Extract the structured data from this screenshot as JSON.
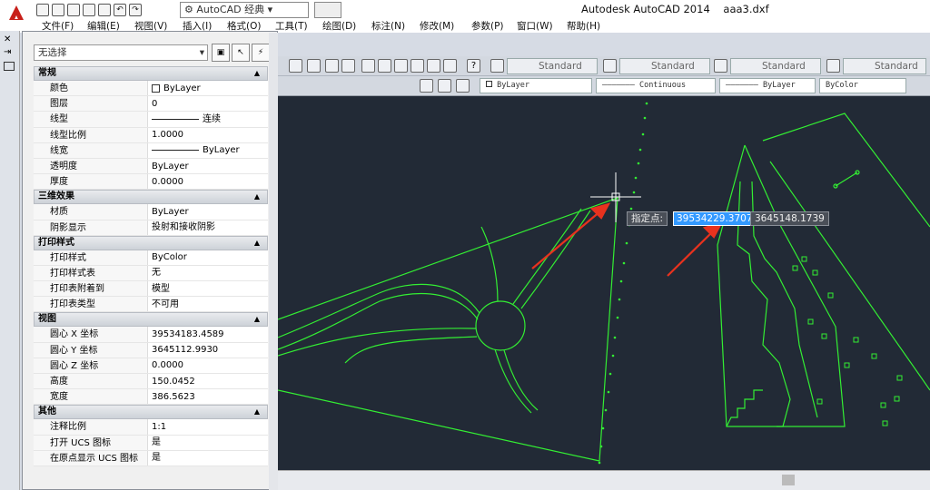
{
  "app": {
    "title": "Autodesk AutoCAD 2014",
    "filename": "aaa3.dxf",
    "workspace": "AutoCAD 经典"
  },
  "menu": [
    "文件(F)",
    "编辑(E)",
    "视图(V)",
    "插入(I)",
    "格式(O)",
    "工具(T)",
    "绘图(D)",
    "标注(N)",
    "修改(M)",
    "参数(P)",
    "窗口(W)",
    "帮助(H)"
  ],
  "toolbar": {
    "styles": [
      "Standard",
      "Standard",
      "Standard",
      "Standard"
    ],
    "layer_color": "ByLayer",
    "linetype": "Continuous",
    "lineweight": "ByLayer",
    "plotstyle": "ByColor"
  },
  "properties": {
    "selection": "无选择",
    "sections": [
      {
        "title": "常规",
        "rows": [
          {
            "k": "颜色",
            "v": "ByLayer",
            "swatch": true
          },
          {
            "k": "图层",
            "v": "0"
          },
          {
            "k": "线型",
            "v": "连续",
            "line": true
          },
          {
            "k": "线型比例",
            "v": "1.0000"
          },
          {
            "k": "线宽",
            "v": "ByLayer",
            "line": true
          },
          {
            "k": "透明度",
            "v": "ByLayer"
          },
          {
            "k": "厚度",
            "v": "0.0000"
          }
        ]
      },
      {
        "title": "三维效果",
        "rows": [
          {
            "k": "材质",
            "v": "ByLayer"
          },
          {
            "k": "阴影显示",
            "v": "投射和接收阴影"
          }
        ]
      },
      {
        "title": "打印样式",
        "rows": [
          {
            "k": "打印样式",
            "v": "ByColor"
          },
          {
            "k": "打印样式表",
            "v": "无"
          },
          {
            "k": "打印表附着到",
            "v": "模型"
          },
          {
            "k": "打印表类型",
            "v": "不可用"
          }
        ]
      },
      {
        "title": "视图",
        "rows": [
          {
            "k": "圆心 X 坐标",
            "v": "39534183.4589"
          },
          {
            "k": "圆心 Y 坐标",
            "v": "3645112.9930"
          },
          {
            "k": "圆心 Z 坐标",
            "v": "0.0000"
          },
          {
            "k": "高度",
            "v": "150.0452"
          },
          {
            "k": "宽度",
            "v": "386.5623"
          }
        ]
      },
      {
        "title": "其他",
        "rows": [
          {
            "k": "注释比例",
            "v": "1:1"
          },
          {
            "k": "打开 UCS 图标",
            "v": "是"
          },
          {
            "k": "在原点显示 UCS 图标",
            "v": "是"
          }
        ]
      }
    ]
  },
  "dynamic_input": {
    "prompt": "指定点:",
    "x_value": "39534229.3707",
    "y_value": "3645148.1739"
  },
  "colors": {
    "canvas": "#222a36",
    "geometry": "#33ee33",
    "annotation_arrow": "#e8321e"
  }
}
